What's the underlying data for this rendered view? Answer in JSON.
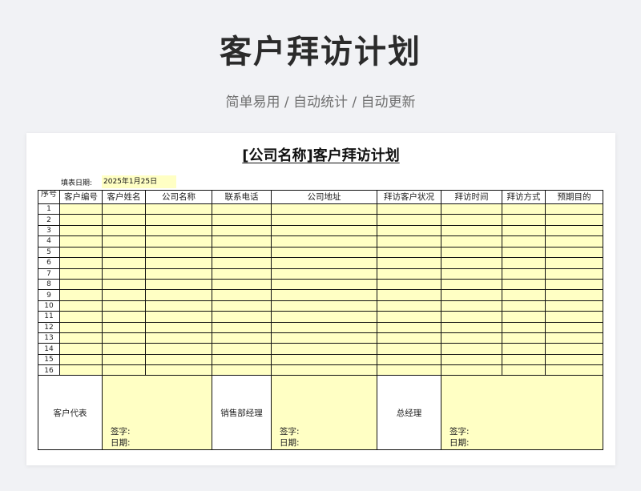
{
  "hero": {
    "title": "客户拜访计划",
    "subtitle": "简单易用 / 自动统计 / 自动更新"
  },
  "sheet": {
    "title": "[公司名称]客户拜访计划",
    "fill_date_label": "填表日期:",
    "fill_date_value": "2025年1月25日",
    "columns": [
      "序号",
      "客户编号",
      "客户姓名",
      "公司名称",
      "联系电话",
      "公司地址",
      "拜访客户状况",
      "拜访时间",
      "拜访方式",
      "预期目的"
    ],
    "row_numbers": [
      "1",
      "2",
      "3",
      "4",
      "5",
      "6",
      "7",
      "8",
      "9",
      "10",
      "11",
      "12",
      "13",
      "14",
      "15",
      "16"
    ],
    "signoff": {
      "customer_rep": "客户代表",
      "sales_manager": "销售部经理",
      "general_manager": "总经理",
      "sign_label": "签字:",
      "date_label": "日期:"
    }
  },
  "colors": {
    "cell_fill": "#ffffc4",
    "page_bg": "#f1f2f5"
  }
}
